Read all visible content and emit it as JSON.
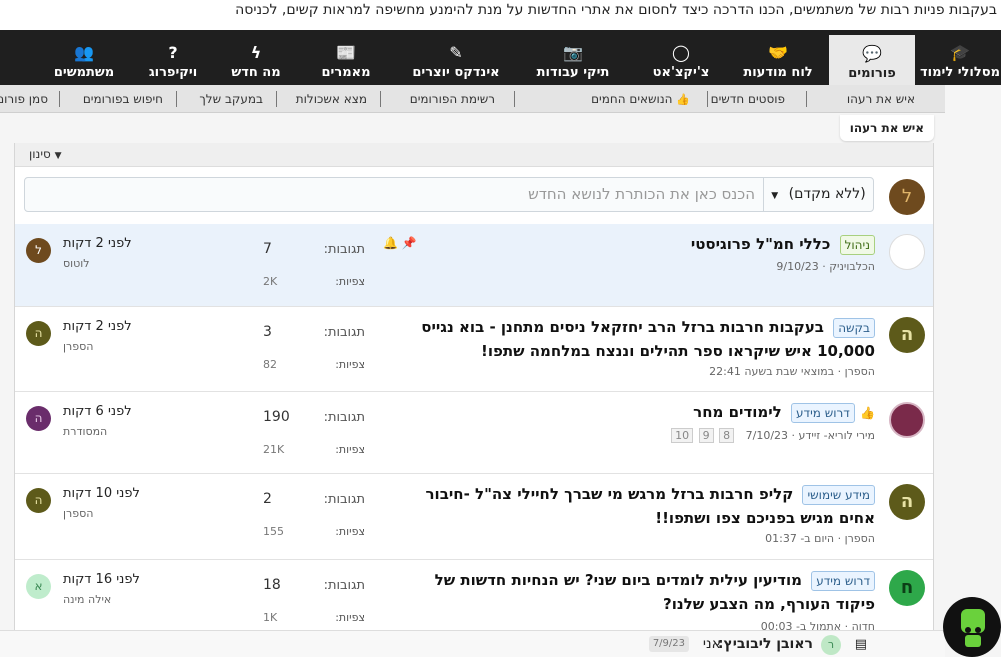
{
  "banner": {
    "text": "בעקבות פניות רבות של משתמשים, הכנו הדרכה כיצד לחסום את אתרי החדשות על מנת להימנע מחשיפה למראות קשים, לכניסה"
  },
  "topnav": {
    "items": [
      {
        "label": "מסלולי לימוד",
        "icon": "graduation-cap-icon",
        "glyph": "🎓"
      },
      {
        "label": "פורומים",
        "icon": "chat-bubbles-icon",
        "glyph": "💬"
      },
      {
        "label": "לוח מודעות",
        "icon": "handshake-icon",
        "glyph": "🤝"
      },
      {
        "label": "צ'יקצ'אט",
        "icon": "chat-icon",
        "glyph": "◯"
      },
      {
        "label": "תיקי עבודות",
        "icon": "camera-icon",
        "glyph": "📷"
      },
      {
        "label": "אינדקס יוצרים",
        "icon": "brush-icon",
        "glyph": "✎"
      },
      {
        "label": "מאמרים",
        "icon": "newspaper-icon",
        "glyph": "📰"
      },
      {
        "label": "מה חדש",
        "icon": "lightning-icon",
        "glyph": "ϟ"
      },
      {
        "label": "ויקיפרוג",
        "icon": "lightbulb-icon",
        "glyph": "?"
      },
      {
        "label": "משתמשים",
        "icon": "users-icon",
        "glyph": "👥"
      }
    ]
  },
  "subnav": {
    "items": [
      {
        "label": "איש את רעהו"
      },
      {
        "label": "פוסטים חדשים"
      },
      {
        "label": "הנושאים החמים",
        "hot": "👍"
      },
      {
        "label": "רשימת הפורומים"
      },
      {
        "label": "מצא אשכולות"
      },
      {
        "label": "במעקב שלך"
      },
      {
        "label": "חיפוש בפורומים"
      },
      {
        "label": "סמן פורומים כנקרא"
      }
    ]
  },
  "crumb": {
    "label": "איש את רעהו"
  },
  "filter": {
    "label": "סינון"
  },
  "new_topic": {
    "prefix": "(ללא מקדם)",
    "placeholder": "הכנס כאן את הכותרת לנושא החדש",
    "avatar_letter": "ל"
  },
  "labels": {
    "replies": "תגובות:",
    "views": "צפיות:"
  },
  "threads": [
    {
      "tag": "ניהול",
      "tag_style": "green",
      "title": "כללי חמ\"ל פרוגיסטי",
      "meta": "הכלבויניק · 9/10/23",
      "replies": "7",
      "views": "2K",
      "last_time": "לפני 2 דקות",
      "last_user": "לוטוס",
      "last_avatar_letter": "ל",
      "last_avatar_color": "#6e4a1e",
      "avatar_letter": "✔",
      "avatar_color": "#ffffff",
      "pinned": true
    },
    {
      "tag": "בקשה",
      "tag_style": "blue",
      "title": "בעקבות חרבות ברזל הרב יחזקאל ניסים מתחנן - בוא נגייס 10,000 איש שיקראו ספר תהילים וננצח במלחמה שתפו!",
      "meta": "הספרן · במוצאי שבת בשעה 22:41",
      "replies": "3",
      "views": "82",
      "last_time": "לפני 2 דקות",
      "last_user": "הספרן",
      "last_avatar_letter": "ה",
      "last_avatar_color": "#5d5a1a",
      "avatar_letter": "ה",
      "avatar_color": "#5d5a1a",
      "pinned": false
    },
    {
      "tag": "דרוש מידע",
      "tag_style": "blue",
      "hot": "👍",
      "title": "לימודים מחר",
      "meta": "מירי לוריא- זיידע · 7/10/23",
      "pages": [
        "10",
        "9",
        "8"
      ],
      "replies": "190",
      "views": "21K",
      "last_time": "לפני 6 דקות",
      "last_user": "המסודרת",
      "last_avatar_letter": "ה",
      "last_avatar_color": "#6a2d6b",
      "avatar_letter": "",
      "avatar_color": "#7a2a4a",
      "pinned": false
    },
    {
      "tag": "מידע שימושי",
      "tag_style": "blue",
      "title": "קליפ חרבות ברזל מרגש מי שברך לחיילי צה\"ל -חיבור אחים מגיש בפניכם צפו ושתפו!!",
      "meta": "הספרן · היום ב- 01:37",
      "replies": "2",
      "views": "155",
      "last_time": "לפני 10 דקות",
      "last_user": "הספרן",
      "last_avatar_letter": "ה",
      "last_avatar_color": "#5d5a1a",
      "avatar_letter": "ה",
      "avatar_color": "#5d5a1a",
      "pinned": false
    },
    {
      "tag": "דרוש מידע",
      "tag_style": "blue",
      "title": "מודיעין עילית לומדים ביום שני? יש הנחיות חדשות של פיקוד העורף, מה הצבע שלנו?",
      "meta": "חדוה · אתמול ב- 00:03",
      "replies": "18",
      "views": "1K",
      "last_time": "לפני 16 דקות",
      "last_user": "אילה מינה",
      "last_avatar_letter": "א",
      "last_avatar_color": "#9adfae",
      "avatar_letter": "ח",
      "avatar_color": "#2ea84a",
      "pinned": false
    }
  ],
  "bottom": {
    "name": "ראובן ליבוביץ:",
    "message": "אני",
    "date": "7/9/23",
    "avatar_letter": "ר"
  },
  "colors": {
    "topnav_bg": "#1f1f1f",
    "accent_blue": "#2d5f8c",
    "pinned_bg": "#eaf2fb"
  }
}
